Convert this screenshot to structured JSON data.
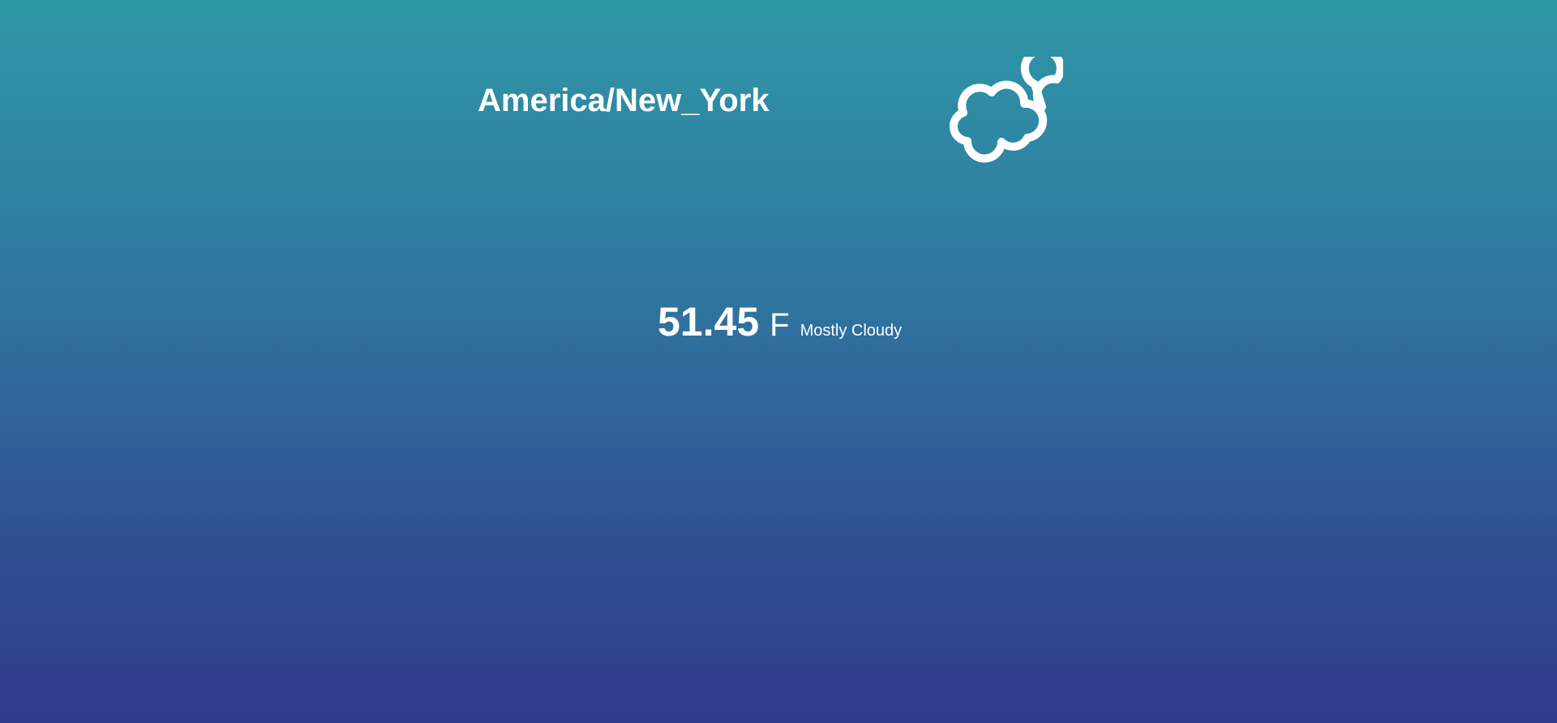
{
  "location": {
    "timezone": "America/New_York"
  },
  "current": {
    "icon": "partly-cloudy-night-icon",
    "temperature": "51.45",
    "unit": "F",
    "summary": "Mostly Cloudy"
  },
  "colors": {
    "background_top": "#2f97a6",
    "background_bottom": "#313a8c",
    "text": "#ffffff"
  }
}
